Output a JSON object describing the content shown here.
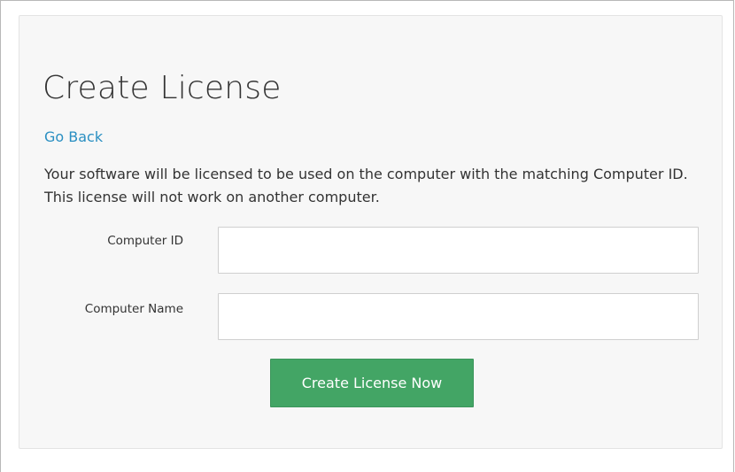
{
  "page": {
    "title": "Create License",
    "go_back": "Go Back",
    "description": "Your software will be licensed to be used on the computer with the matching Computer ID. This license will not work on another computer."
  },
  "form": {
    "computer_id_label": "Computer ID",
    "computer_id_value": "",
    "computer_name_label": "Computer Name",
    "computer_name_value": "",
    "submit_label": "Create License Now"
  },
  "colors": {
    "link": "#2a8fc2",
    "button": "#43a565",
    "panel": "#f7f7f7"
  }
}
